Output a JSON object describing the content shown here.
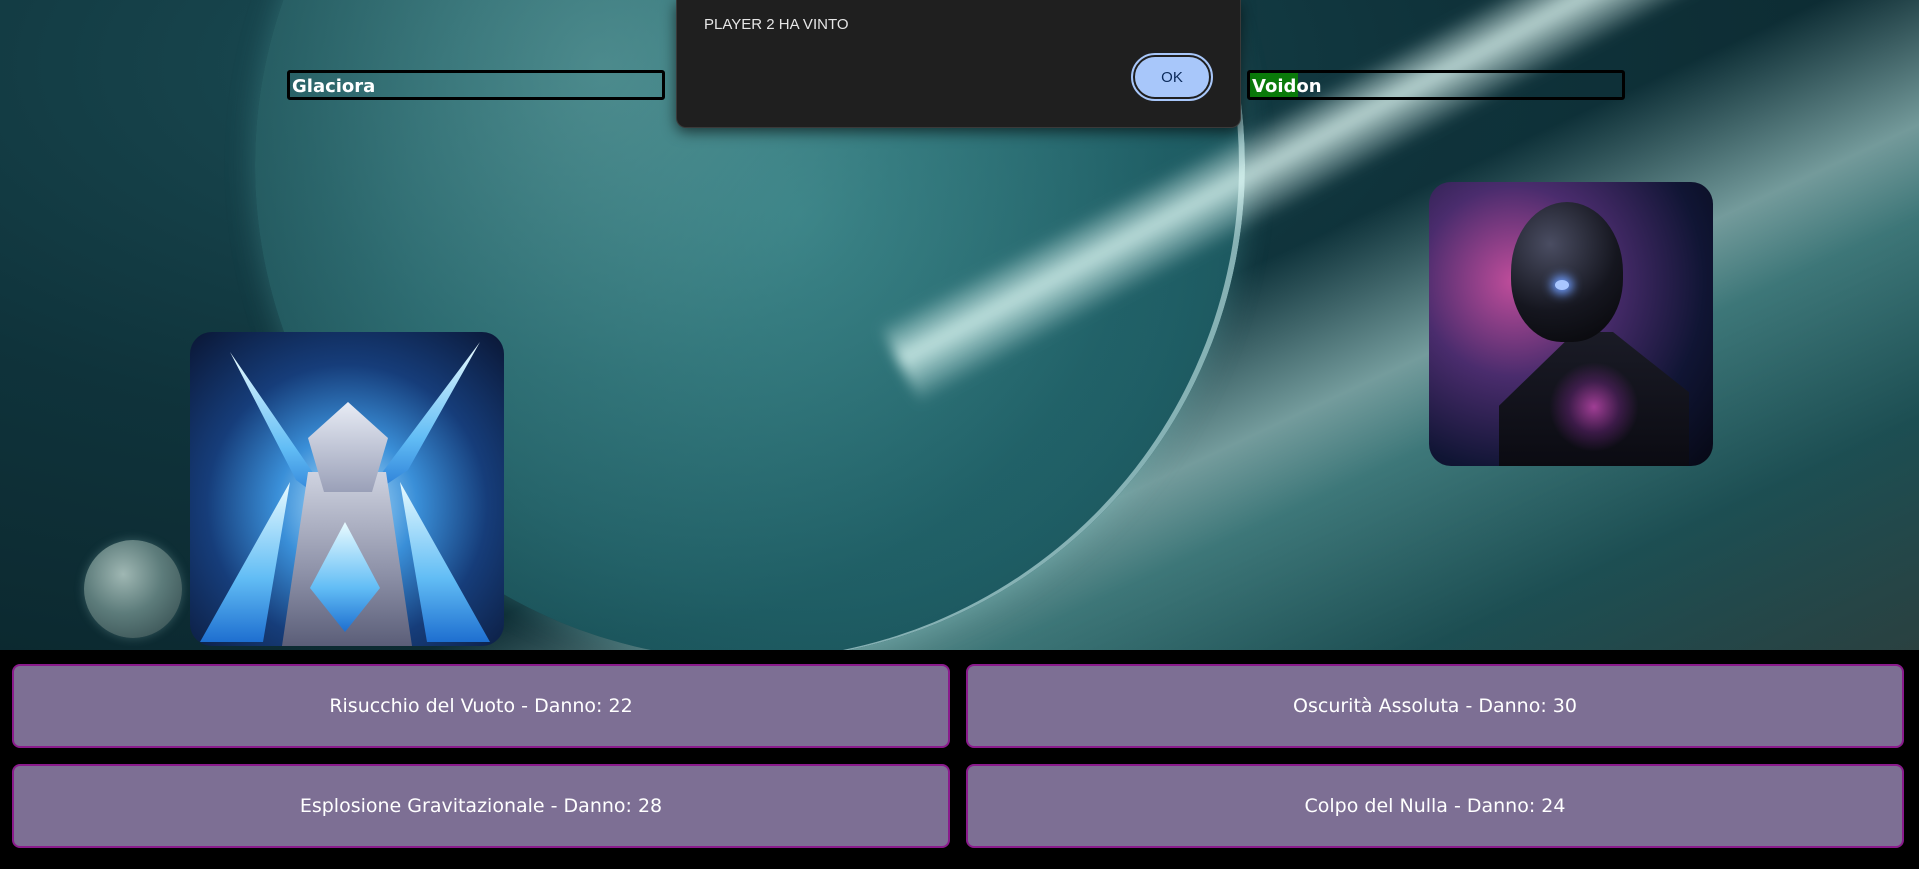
{
  "dialog": {
    "message": "PLAYER 2 HA VINTO",
    "ok_label": "OK"
  },
  "player1": {
    "name": "Glaciora",
    "hp_fraction": 0.0
  },
  "player2": {
    "name": "Voidon",
    "hp_fraction": 0.13
  },
  "moves": [
    {
      "label": "Risucchio del Vuoto - Danno: 22"
    },
    {
      "label": "Oscurità Assoluta - Danno: 30"
    },
    {
      "label": "Esplosione Gravitazionale - Danno: 28"
    },
    {
      "label": "Colpo del Nulla - Danno: 24"
    }
  ],
  "colors": {
    "hp_fill": "#0a7a0a",
    "move_bg": "#7d6f94",
    "move_border": "#8a1b8c",
    "dialog_bg": "#1f1f1f",
    "ok_button": "#a8c7fa"
  }
}
